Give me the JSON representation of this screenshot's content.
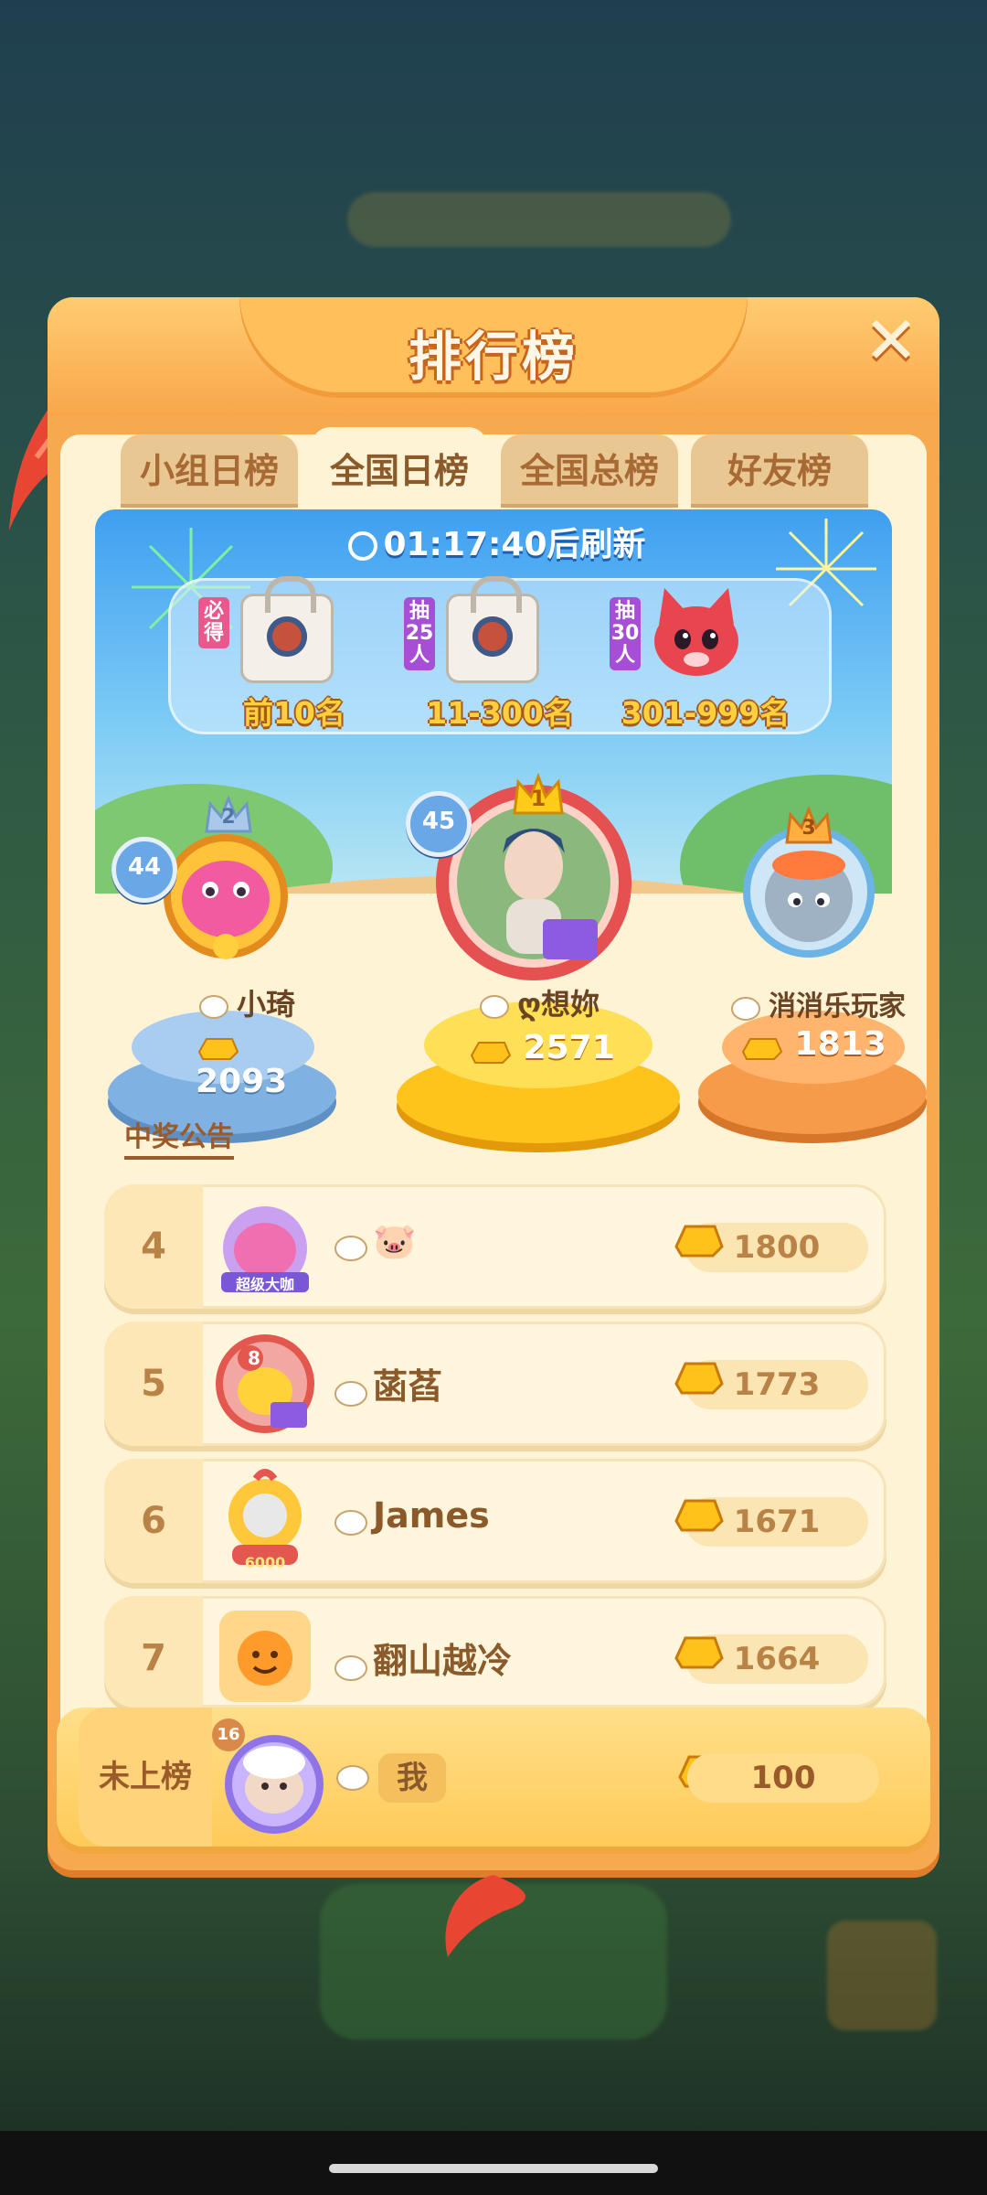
{
  "panel": {
    "title": "排行榜",
    "close_label": "✕",
    "tabs": [
      {
        "label": "小组日榜",
        "active": false
      },
      {
        "label": "全国日榜",
        "active": true
      },
      {
        "label": "全国总榜",
        "active": false
      },
      {
        "label": "好友榜",
        "active": false
      }
    ],
    "timer": "01:17:40后刷新",
    "rewards": [
      {
        "tag": "必得",
        "label": "前10名"
      },
      {
        "tag": "抽25人",
        "label": "11-300名"
      },
      {
        "tag": "抽30人",
        "label": "301-999名"
      }
    ],
    "podium": [
      {
        "place": "2",
        "level": "44",
        "name": "小琦",
        "score": "2093"
      },
      {
        "place": "1",
        "level": "45",
        "name": "ღ想妳",
        "score": "2571"
      },
      {
        "place": "3",
        "level": "",
        "name": "消消乐玩家",
        "score": "1813"
      }
    ],
    "announcement_label": "中奖公告",
    "list": [
      {
        "rank": "4",
        "name": "🐷",
        "score": "1800",
        "badge_text": "超级大咖"
      },
      {
        "rank": "5",
        "name": "菡萏",
        "score": "1773",
        "badge_text": "8"
      },
      {
        "rank": "6",
        "name": "James",
        "score": "1671",
        "badge_text": "6000"
      },
      {
        "rank": "7",
        "name": "翻山越冷",
        "score": "1664",
        "badge_text": ""
      }
    ],
    "me": {
      "rank_label": "未上榜",
      "name": "我",
      "score": "100",
      "level": "16"
    },
    "colors": {
      "panel": "#f6a94d",
      "inner": "#fff3d6",
      "accent": "#8b5a2b"
    }
  }
}
